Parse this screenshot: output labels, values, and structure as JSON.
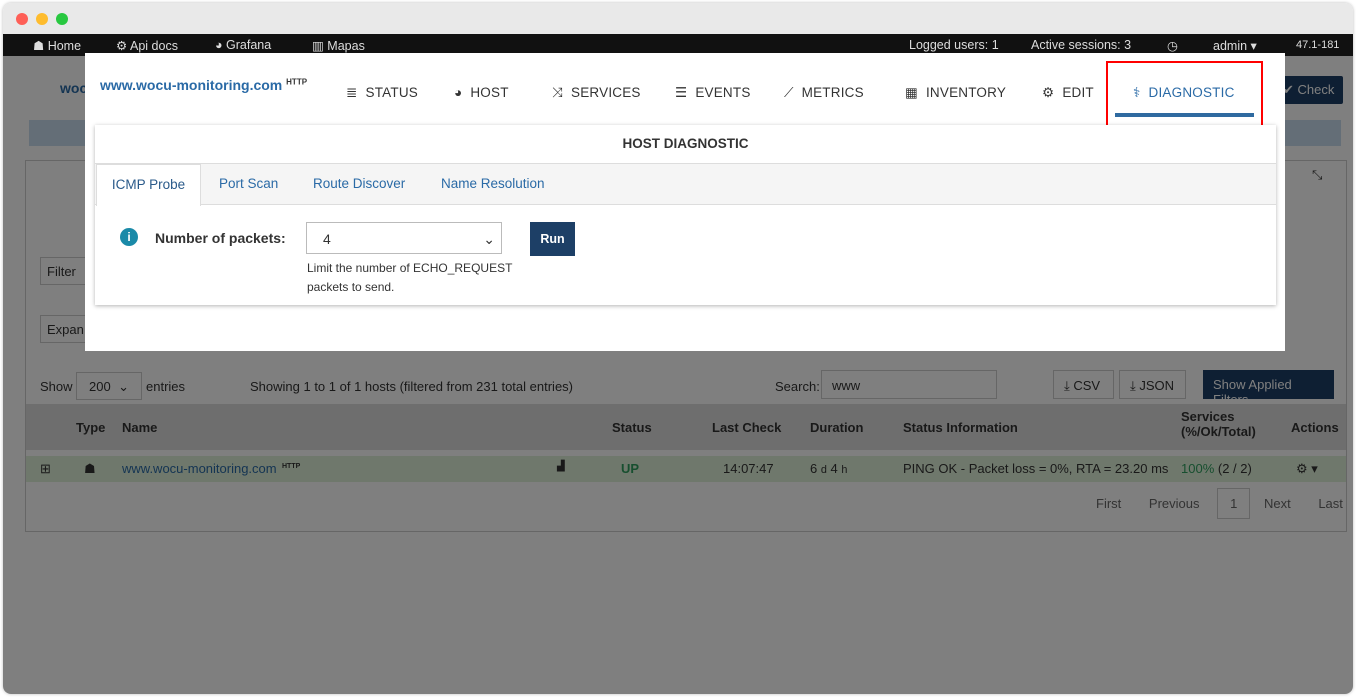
{
  "topnav": {
    "home": "Home",
    "api_docs": "Api docs",
    "grafana": "Grafana",
    "mapas": "Mapas",
    "logged_users": "Logged users: 1",
    "active_sessions": "Active sessions: 3",
    "user": "admin",
    "version": "47.1-181"
  },
  "background": {
    "host_prefix": "woc",
    "check_button": "Check",
    "filter_label": "Filter",
    "expand_label": "Expan",
    "table": {
      "show": "Show",
      "entries_value": "200",
      "entries": "entries",
      "showing": "Showing 1 to 1 of 1 hosts (filtered from 231 total entries)",
      "search_label": "Search:",
      "search_value": "www",
      "csv": "CSV",
      "json": "JSON",
      "show_filters": "Show Applied Filters",
      "headers": [
        "Type",
        "Name",
        "Status",
        "Last Check",
        "Duration",
        "Status Information",
        "Services (%/Ok/Total)",
        "Actions"
      ],
      "row": {
        "name": "www.wocu-monitoring.com",
        "tag": "HTTP",
        "status": "UP",
        "last_check": "14:07:47",
        "duration_d": "6",
        "duration_d_unit": "d",
        "duration_h": "4",
        "duration_h_unit": "h",
        "info": "PING OK - Packet loss = 0%, RTA = 23.20 ms",
        "services_pct": "100%",
        "services_count": "(2 / 2)"
      },
      "pagination": [
        "First",
        "Previous",
        "1",
        "Next",
        "Last"
      ]
    }
  },
  "modal": {
    "host": "www.wocu-monitoring.com",
    "host_tag": "HTTP",
    "nav": [
      {
        "label": "STATUS",
        "icon": "list-icon"
      },
      {
        "label": "HOST",
        "icon": "dashboard-icon"
      },
      {
        "label": "SERVICES",
        "icon": "shuffle-icon"
      },
      {
        "label": "EVENTS",
        "icon": "database-icon"
      },
      {
        "label": "METRICS",
        "icon": "chart-icon"
      },
      {
        "label": "INVENTORY",
        "icon": "grid-icon"
      },
      {
        "label": "EDIT",
        "icon": "gears-icon"
      },
      {
        "label": "DIAGNOSTIC",
        "icon": "stethoscope-icon",
        "active": true
      }
    ],
    "card_title": "HOST DIAGNOSTIC",
    "tabs": [
      "ICMP Probe",
      "Port Scan",
      "Route Discover",
      "Name Resolution"
    ],
    "form": {
      "label": "Number of packets:",
      "value": "4",
      "help": "Limit the number of ECHO_REQUEST packets to send.",
      "run": "Run"
    }
  },
  "colors": {
    "accent": "#2a6aa6",
    "dark_button": "#1d3f66",
    "highlight": "#ff0000",
    "up": "#2e9e5e"
  }
}
